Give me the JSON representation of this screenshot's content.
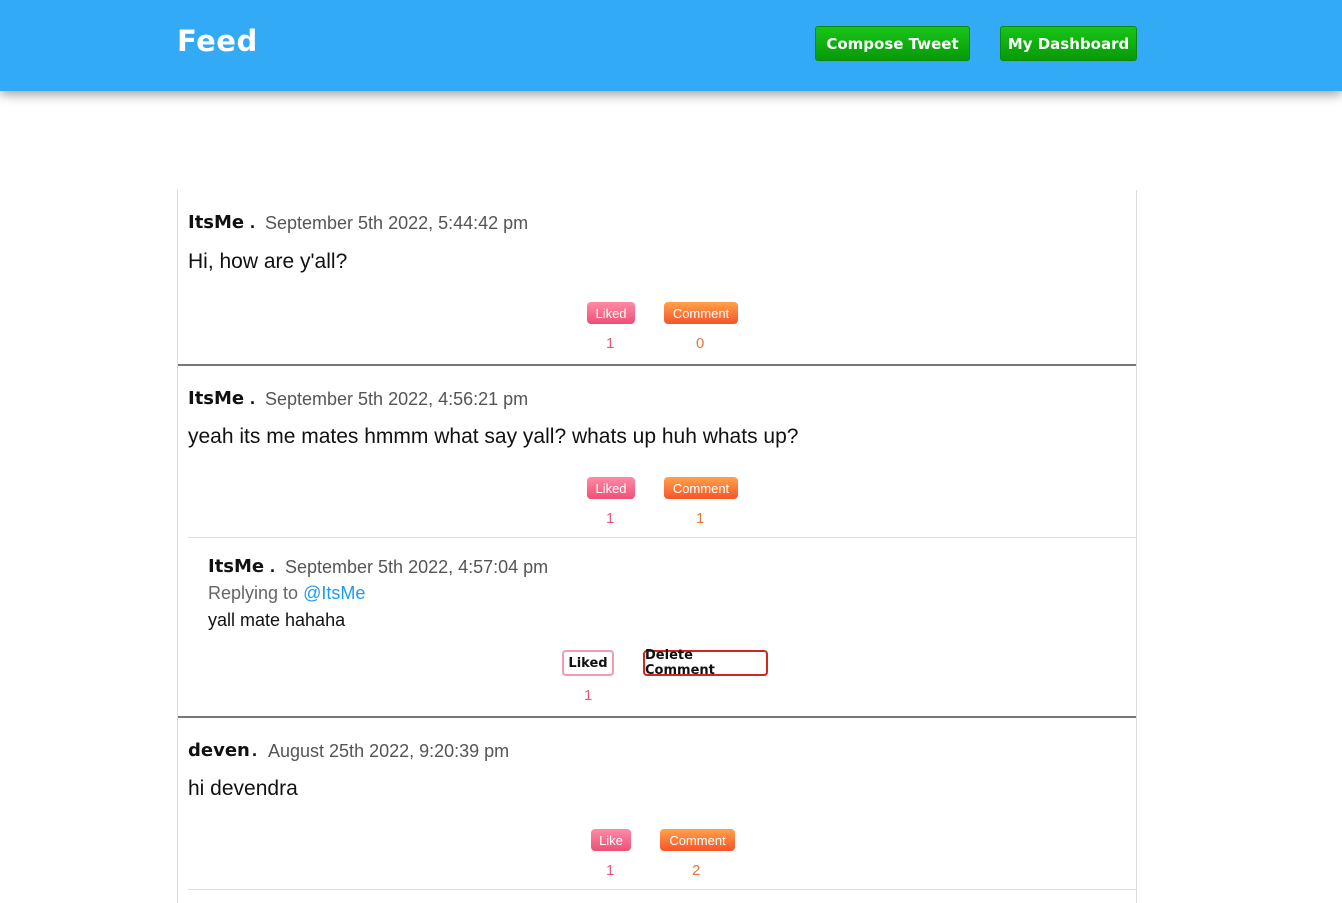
{
  "header": {
    "title": "Feed",
    "compose_label": "Compose Tweet",
    "dashboard_label": "My Dashboard",
    "background": "#33aaf6",
    "button_color": "#11b011"
  },
  "tweets": [
    {
      "author": "ItsMe",
      "dot": ".",
      "date": "September 5th 2022, 5:44:42 pm",
      "text": "Hi, how are y'all?",
      "like_label": "Liked",
      "like_count": "1",
      "comment_label": "Comment",
      "comment_count": "0"
    },
    {
      "author": "ItsMe",
      "dot": ".",
      "date": "September 5th 2022, 4:56:21 pm",
      "text": "yeah its me mates hmmm what say yall? whats up huh whats up?",
      "like_label": "Liked",
      "like_count": "1",
      "comment_label": "Comment",
      "comment_count": "1",
      "reply": {
        "author": "ItsMe",
        "dot": ".",
        "date": "September 5th 2022, 4:57:04 pm",
        "replying_to_label": "Replying to",
        "replying_to_handle": "@ItsMe",
        "text": "yall mate hahaha",
        "like_label": "Liked",
        "like_count": "1",
        "delete_label": "Delete Comment"
      }
    },
    {
      "author": "deven",
      "dot": ".",
      "date": "August 25th 2022, 9:20:39 pm",
      "text": "hi devendra",
      "like_label": "Like",
      "like_count": "1",
      "comment_label": "Comment",
      "comment_count": "2"
    }
  ]
}
